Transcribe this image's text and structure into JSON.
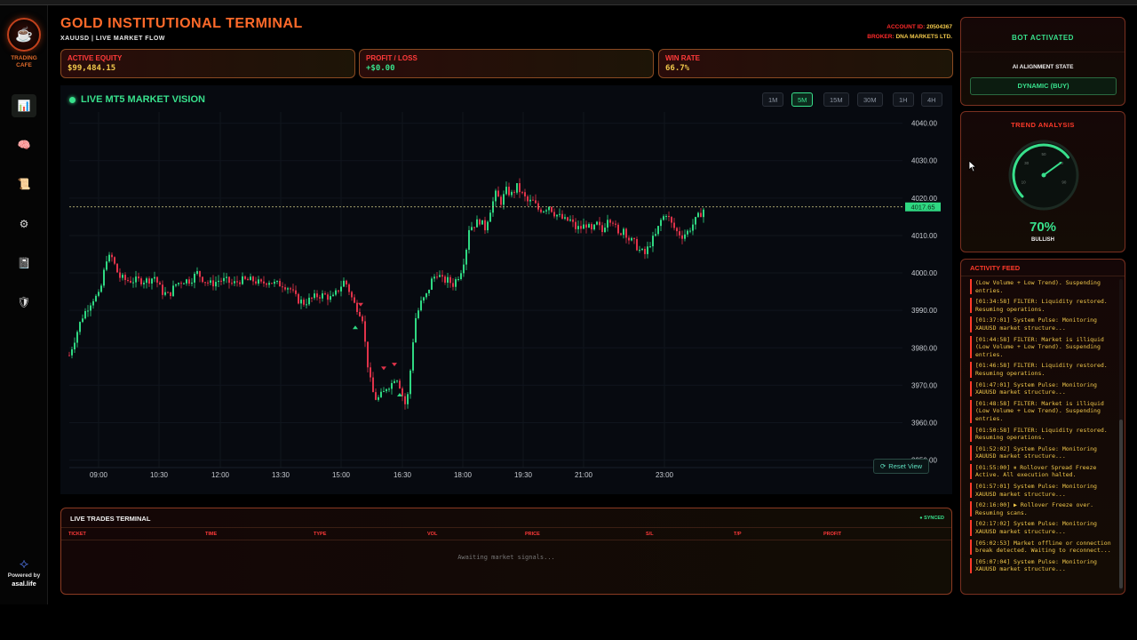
{
  "sidebar": {
    "brand_line1": "TRADING",
    "brand_line2": "CAFE",
    "nav": [
      {
        "icon": "📊",
        "name": "chart-icon"
      },
      {
        "icon": "🧠",
        "name": "brain-icon"
      },
      {
        "icon": "📜",
        "name": "scroll-icon"
      },
      {
        "icon": "⚙",
        "name": "gear-icon"
      },
      {
        "icon": "📓",
        "name": "notebook-icon"
      },
      {
        "icon": "🛡",
        "name": "shield-icon"
      }
    ],
    "powered_label": "Powered by",
    "powered_brand": "asal.life"
  },
  "header": {
    "title": "GOLD INSTITUTIONAL TERMINAL",
    "subtitle": "XAUUSD | LIVE MARKET FLOW",
    "account_label": "ACCOUNT ID:",
    "account_id": "20504367",
    "broker_label": "BROKER:",
    "broker": "DNA MARKETS LTD."
  },
  "stats": [
    {
      "label": "ACTIVE EQUITY",
      "value": "$99,484.15",
      "color": "#f1c84b"
    },
    {
      "label": "PROFIT / LOSS",
      "value": "+$0.00",
      "color": "#38e08c"
    },
    {
      "label": "WIN RATE",
      "value": "66.7%",
      "color": "#f1c84b"
    }
  ],
  "chart": {
    "title": "LIVE MT5 MARKET VISION",
    "timeframes": [
      "1M",
      "5M",
      "15M",
      "30M",
      "1H",
      "4H"
    ],
    "active_timeframe": "5M",
    "reset_label": "Reset View",
    "current_price": "4017.65"
  },
  "chart_data": {
    "type": "candlestick",
    "symbol": "XAUUSD",
    "ylim": [
      3948,
      4043
    ],
    "y_ticks": [
      "4040.00",
      "4030.00",
      "4020.00",
      "4010.00",
      "4000.00",
      "3990.00",
      "3980.00",
      "3970.00",
      "3960.00",
      "3950.00"
    ],
    "x_ticks": [
      "09:00",
      "10:30",
      "12:00",
      "13:30",
      "15:00",
      "16:30",
      "18:00",
      "19:30",
      "21:00",
      "23:00"
    ],
    "last_price": 4017.65,
    "path_points": [
      [
        0,
        3978
      ],
      [
        14,
        3988
      ],
      [
        26,
        3993
      ],
      [
        34,
        3994
      ],
      [
        42,
        4004
      ],
      [
        48,
        4004
      ],
      [
        56,
        3999
      ],
      [
        64,
        3998
      ],
      [
        72,
        3998
      ],
      [
        80,
        3998
      ],
      [
        88,
        3998
      ],
      [
        96,
        3999
      ],
      [
        104,
        3995
      ],
      [
        112,
        3994
      ],
      [
        120,
        3997
      ],
      [
        128,
        3998
      ],
      [
        136,
        3998
      ],
      [
        144,
        4000
      ],
      [
        152,
        3998
      ],
      [
        160,
        3997
      ],
      [
        168,
        3998
      ],
      [
        176,
        3998
      ],
      [
        184,
        3997
      ],
      [
        192,
        3998
      ],
      [
        200,
        3998
      ],
      [
        208,
        3998
      ],
      [
        216,
        3997
      ],
      [
        224,
        3998
      ],
      [
        232,
        3997
      ],
      [
        240,
        3997
      ],
      [
        248,
        3996
      ],
      [
        256,
        3993
      ],
      [
        264,
        3992
      ],
      [
        272,
        3993
      ],
      [
        280,
        3994
      ],
      [
        288,
        3994
      ],
      [
        296,
        3993
      ],
      [
        304,
        3996
      ],
      [
        310,
        3998
      ],
      [
        314,
        3996
      ],
      [
        320,
        3992
      ],
      [
        326,
        3990
      ],
      [
        330,
        3988
      ],
      [
        334,
        3979
      ],
      [
        338,
        3972
      ],
      [
        342,
        3968
      ],
      [
        346,
        3966
      ],
      [
        350,
        3967
      ],
      [
        354,
        3968
      ],
      [
        358,
        3970
      ],
      [
        362,
        3970
      ],
      [
        366,
        3972
      ],
      [
        370,
        3972
      ],
      [
        374,
        3968
      ],
      [
        378,
        3965
      ],
      [
        382,
        3968
      ],
      [
        386,
        3980
      ],
      [
        390,
        3988
      ],
      [
        396,
        3992
      ],
      [
        402,
        3994
      ],
      [
        408,
        3998
      ],
      [
        414,
        4000
      ],
      [
        420,
        3998
      ],
      [
        426,
        3998
      ],
      [
        432,
        3997
      ],
      [
        440,
        4000
      ],
      [
        446,
        4005
      ],
      [
        450,
        4012
      ],
      [
        456,
        4013
      ],
      [
        462,
        4014
      ],
      [
        468,
        4012
      ],
      [
        474,
        4017
      ],
      [
        480,
        4021
      ],
      [
        486,
        4019
      ],
      [
        492,
        4022
      ],
      [
        498,
        4021
      ],
      [
        504,
        4023
      ],
      [
        510,
        4021
      ],
      [
        516,
        4019
      ],
      [
        522,
        4019
      ],
      [
        528,
        4017
      ],
      [
        534,
        4017
      ],
      [
        540,
        4018
      ],
      [
        546,
        4016
      ],
      [
        552,
        4015
      ],
      [
        558,
        4014
      ],
      [
        564,
        4014
      ],
      [
        570,
        4012
      ],
      [
        576,
        4012
      ],
      [
        582,
        4013
      ],
      [
        588,
        4011
      ],
      [
        594,
        4013
      ],
      [
        600,
        4011
      ],
      [
        606,
        4015
      ],
      [
        612,
        4014
      ],
      [
        618,
        4010
      ],
      [
        624,
        4012
      ],
      [
        630,
        4009
      ],
      [
        636,
        4008
      ],
      [
        642,
        4006
      ],
      [
        648,
        4005
      ],
      [
        654,
        4008
      ],
      [
        660,
        4010
      ],
      [
        666,
        4014
      ],
      [
        672,
        4016
      ],
      [
        678,
        4013
      ],
      [
        684,
        4011
      ],
      [
        690,
        4010
      ],
      [
        696,
        4011
      ],
      [
        702,
        4013
      ],
      [
        708,
        4015
      ],
      [
        714,
        4017
      ]
    ],
    "buy_markers": [
      [
        322,
        3985
      ],
      [
        372,
        3967
      ]
    ],
    "sell_markers": [
      [
        328,
        3992
      ],
      [
        354,
        3975
      ],
      [
        366,
        3976
      ]
    ]
  },
  "trades": {
    "title": "LIVE TRADES TERMINAL",
    "status": "● SYNCED",
    "columns": [
      "TICKET",
      "TIME",
      "TYPE",
      "VOL",
      "PRICE",
      "S/L",
      "T/P",
      "PROFIT"
    ],
    "empty_text": "Awaiting market signals..."
  },
  "bot": {
    "status": "BOT ACTIVATED",
    "alignment_label": "AI ALIGNMENT STATE",
    "alignment_value": "DYNAMIC (BUY)"
  },
  "trend": {
    "title": "TREND ANALYSIS",
    "gauge_ticks": [
      "10",
      "30",
      "50",
      "70",
      "90"
    ],
    "value": 70,
    "value_text": "70%",
    "label": "BULLISH"
  },
  "feed": {
    "title": "ACTIVITY FEED",
    "items": [
      "(Low Volume + Low Trend). Suspending entries.",
      "[01:34:58] FILTER: Liquidity restored. Resuming operations.",
      "[01:37:01] System Pulse: Monitoring XAUUSD market structure...",
      "[01:44:58] FILTER: Market is illiquid (Low Volume + Low Trend). Suspending entries.",
      "[01:46:58] FILTER: Liquidity restored. Resuming operations.",
      "[01:47:01] System Pulse: Monitoring XAUUSD market structure...",
      "[01:48:58] FILTER: Market is illiquid (Low Volume + Low Trend). Suspending entries.",
      "[01:50:58] FILTER: Liquidity restored. Resuming operations.",
      "[01:52:02] System Pulse: Monitoring XAUUSD market structure...",
      "[01:55:00] ⏸ Rollover Spread Freeze Active. All execution halted.",
      "[01:57:01] System Pulse: Monitoring XAUUSD market structure...",
      "[02:16:00] ▶ Rollover Freeze over. Resuming scans.",
      "[02:17:02] System Pulse: Monitoring XAUUSD market structure...",
      "[05:02:53] Market offline or connection break detected. Waiting to reconnect...",
      "[05:07:04] System Pulse: Monitoring XAUUSD market structure..."
    ]
  }
}
